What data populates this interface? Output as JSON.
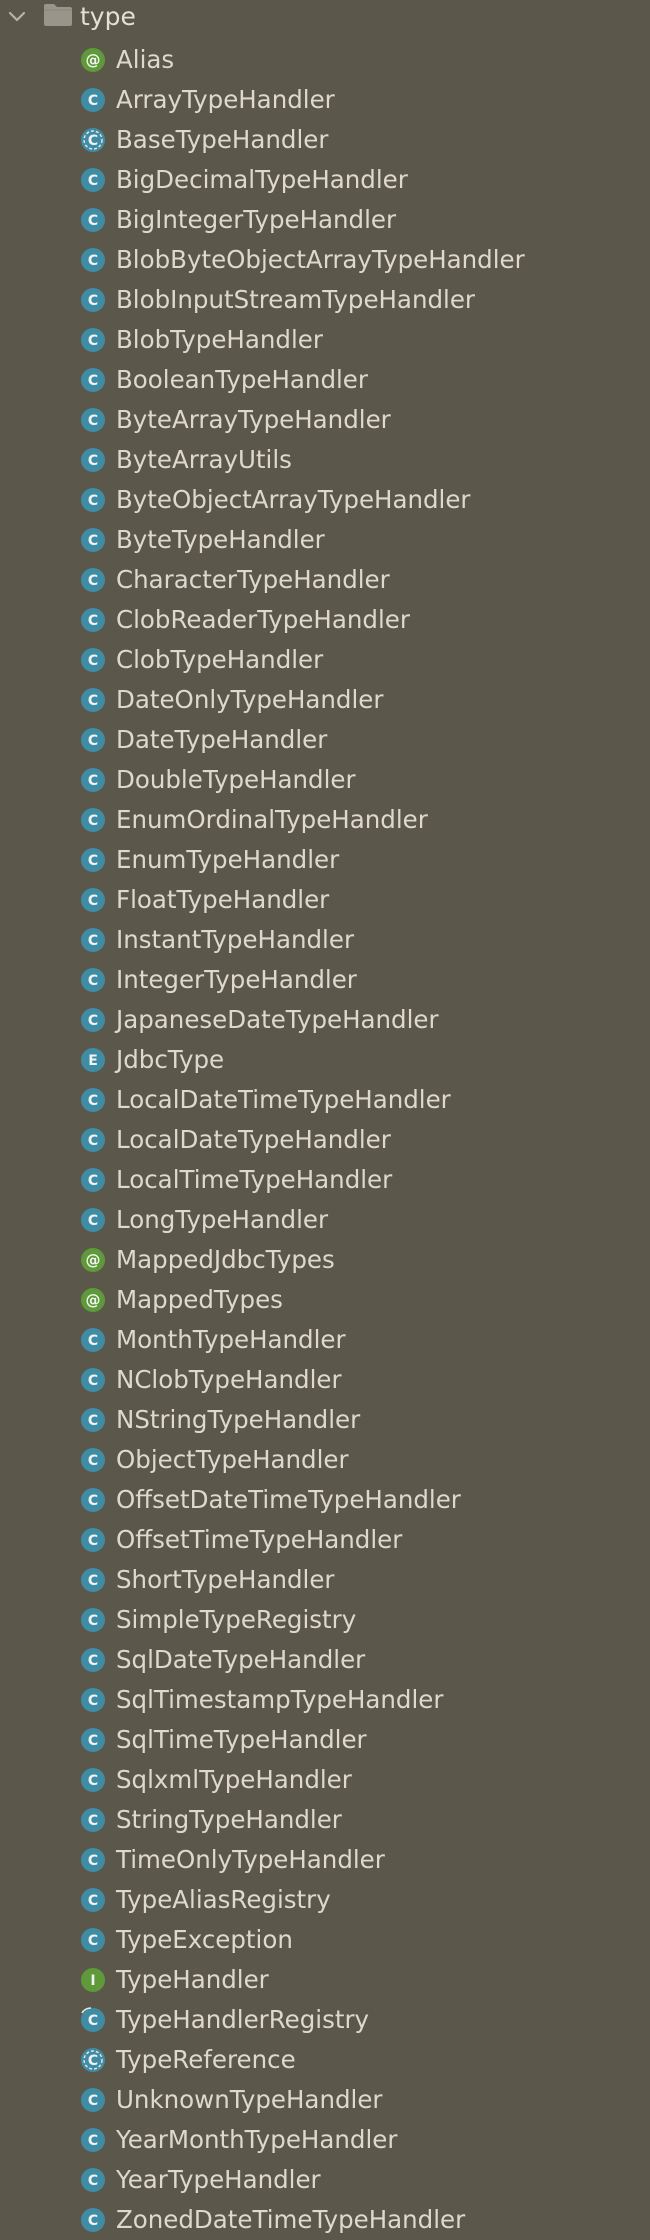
{
  "folder": {
    "label": "type",
    "icon": "folder-icon",
    "expanded": true
  },
  "colors": {
    "background": "#5c574b",
    "class_badge": "#3f8ca5",
    "annotation_badge": "#5e9a3a",
    "interface_badge": "#5e9a3a",
    "enum_badge": "#3f8ca5",
    "text": "#ddd9cf",
    "folder": "#9a958a"
  },
  "items": [
    {
      "label": "Alias",
      "kind": "annotation",
      "icon": "annotation-icon"
    },
    {
      "label": "ArrayTypeHandler",
      "kind": "class",
      "icon": "class-icon"
    },
    {
      "label": "BaseTypeHandler",
      "kind": "abstract",
      "icon": "abstract-class-icon"
    },
    {
      "label": "BigDecimalTypeHandler",
      "kind": "class",
      "icon": "class-icon"
    },
    {
      "label": "BigIntegerTypeHandler",
      "kind": "class",
      "icon": "class-icon"
    },
    {
      "label": "BlobByteObjectArrayTypeHandler",
      "kind": "class",
      "icon": "class-icon"
    },
    {
      "label": "BlobInputStreamTypeHandler",
      "kind": "class",
      "icon": "class-icon"
    },
    {
      "label": "BlobTypeHandler",
      "kind": "class",
      "icon": "class-icon"
    },
    {
      "label": "BooleanTypeHandler",
      "kind": "class",
      "icon": "class-icon"
    },
    {
      "label": "ByteArrayTypeHandler",
      "kind": "class",
      "icon": "class-icon"
    },
    {
      "label": "ByteArrayUtils",
      "kind": "class",
      "icon": "class-icon"
    },
    {
      "label": "ByteObjectArrayTypeHandler",
      "kind": "class",
      "icon": "class-icon"
    },
    {
      "label": "ByteTypeHandler",
      "kind": "class",
      "icon": "class-icon"
    },
    {
      "label": "CharacterTypeHandler",
      "kind": "class",
      "icon": "class-icon"
    },
    {
      "label": "ClobReaderTypeHandler",
      "kind": "class",
      "icon": "class-icon"
    },
    {
      "label": "ClobTypeHandler",
      "kind": "class",
      "icon": "class-icon"
    },
    {
      "label": "DateOnlyTypeHandler",
      "kind": "class",
      "icon": "class-icon"
    },
    {
      "label": "DateTypeHandler",
      "kind": "class",
      "icon": "class-icon"
    },
    {
      "label": "DoubleTypeHandler",
      "kind": "class",
      "icon": "class-icon"
    },
    {
      "label": "EnumOrdinalTypeHandler",
      "kind": "class",
      "icon": "class-icon"
    },
    {
      "label": "EnumTypeHandler",
      "kind": "class",
      "icon": "class-icon"
    },
    {
      "label": "FloatTypeHandler",
      "kind": "class",
      "icon": "class-icon"
    },
    {
      "label": "InstantTypeHandler",
      "kind": "class",
      "icon": "class-icon"
    },
    {
      "label": "IntegerTypeHandler",
      "kind": "class",
      "icon": "class-icon"
    },
    {
      "label": "JapaneseDateTypeHandler",
      "kind": "class",
      "icon": "class-icon"
    },
    {
      "label": "JdbcType",
      "kind": "enum",
      "icon": "enum-icon"
    },
    {
      "label": "LocalDateTimeTypeHandler",
      "kind": "class",
      "icon": "class-icon"
    },
    {
      "label": "LocalDateTypeHandler",
      "kind": "class",
      "icon": "class-icon"
    },
    {
      "label": "LocalTimeTypeHandler",
      "kind": "class",
      "icon": "class-icon"
    },
    {
      "label": "LongTypeHandler",
      "kind": "class",
      "icon": "class-icon"
    },
    {
      "label": "MappedJdbcTypes",
      "kind": "annotation",
      "icon": "annotation-icon"
    },
    {
      "label": "MappedTypes",
      "kind": "annotation",
      "icon": "annotation-icon"
    },
    {
      "label": "MonthTypeHandler",
      "kind": "class",
      "icon": "class-icon"
    },
    {
      "label": "NClobTypeHandler",
      "kind": "class",
      "icon": "class-icon"
    },
    {
      "label": "NStringTypeHandler",
      "kind": "class",
      "icon": "class-icon"
    },
    {
      "label": "ObjectTypeHandler",
      "kind": "class",
      "icon": "class-icon"
    },
    {
      "label": "OffsetDateTimeTypeHandler",
      "kind": "class",
      "icon": "class-icon"
    },
    {
      "label": "OffsetTimeTypeHandler",
      "kind": "class",
      "icon": "class-icon"
    },
    {
      "label": "ShortTypeHandler",
      "kind": "class",
      "icon": "class-icon"
    },
    {
      "label": "SimpleTypeRegistry",
      "kind": "class",
      "icon": "class-icon"
    },
    {
      "label": "SqlDateTypeHandler",
      "kind": "class",
      "icon": "class-icon"
    },
    {
      "label": "SqlTimestampTypeHandler",
      "kind": "class",
      "icon": "class-icon"
    },
    {
      "label": "SqlTimeTypeHandler",
      "kind": "class",
      "icon": "class-icon"
    },
    {
      "label": "SqlxmlTypeHandler",
      "kind": "class",
      "icon": "class-icon"
    },
    {
      "label": "StringTypeHandler",
      "kind": "class",
      "icon": "class-icon"
    },
    {
      "label": "TimeOnlyTypeHandler",
      "kind": "class",
      "icon": "class-icon"
    },
    {
      "label": "TypeAliasRegistry",
      "kind": "class",
      "icon": "class-icon"
    },
    {
      "label": "TypeException",
      "kind": "class",
      "icon": "class-icon"
    },
    {
      "label": "TypeHandler",
      "kind": "interface",
      "icon": "interface-icon"
    },
    {
      "label": "TypeHandlerRegistry",
      "kind": "class-modified",
      "icon": "class-icon"
    },
    {
      "label": "TypeReference",
      "kind": "abstract",
      "icon": "abstract-class-icon"
    },
    {
      "label": "UnknownTypeHandler",
      "kind": "class",
      "icon": "class-icon"
    },
    {
      "label": "YearMonthTypeHandler",
      "kind": "class",
      "icon": "class-icon"
    },
    {
      "label": "YearTypeHandler",
      "kind": "class",
      "icon": "class-icon"
    },
    {
      "label": "ZonedDateTimeTypeHandler",
      "kind": "class",
      "icon": "class-icon"
    }
  ]
}
